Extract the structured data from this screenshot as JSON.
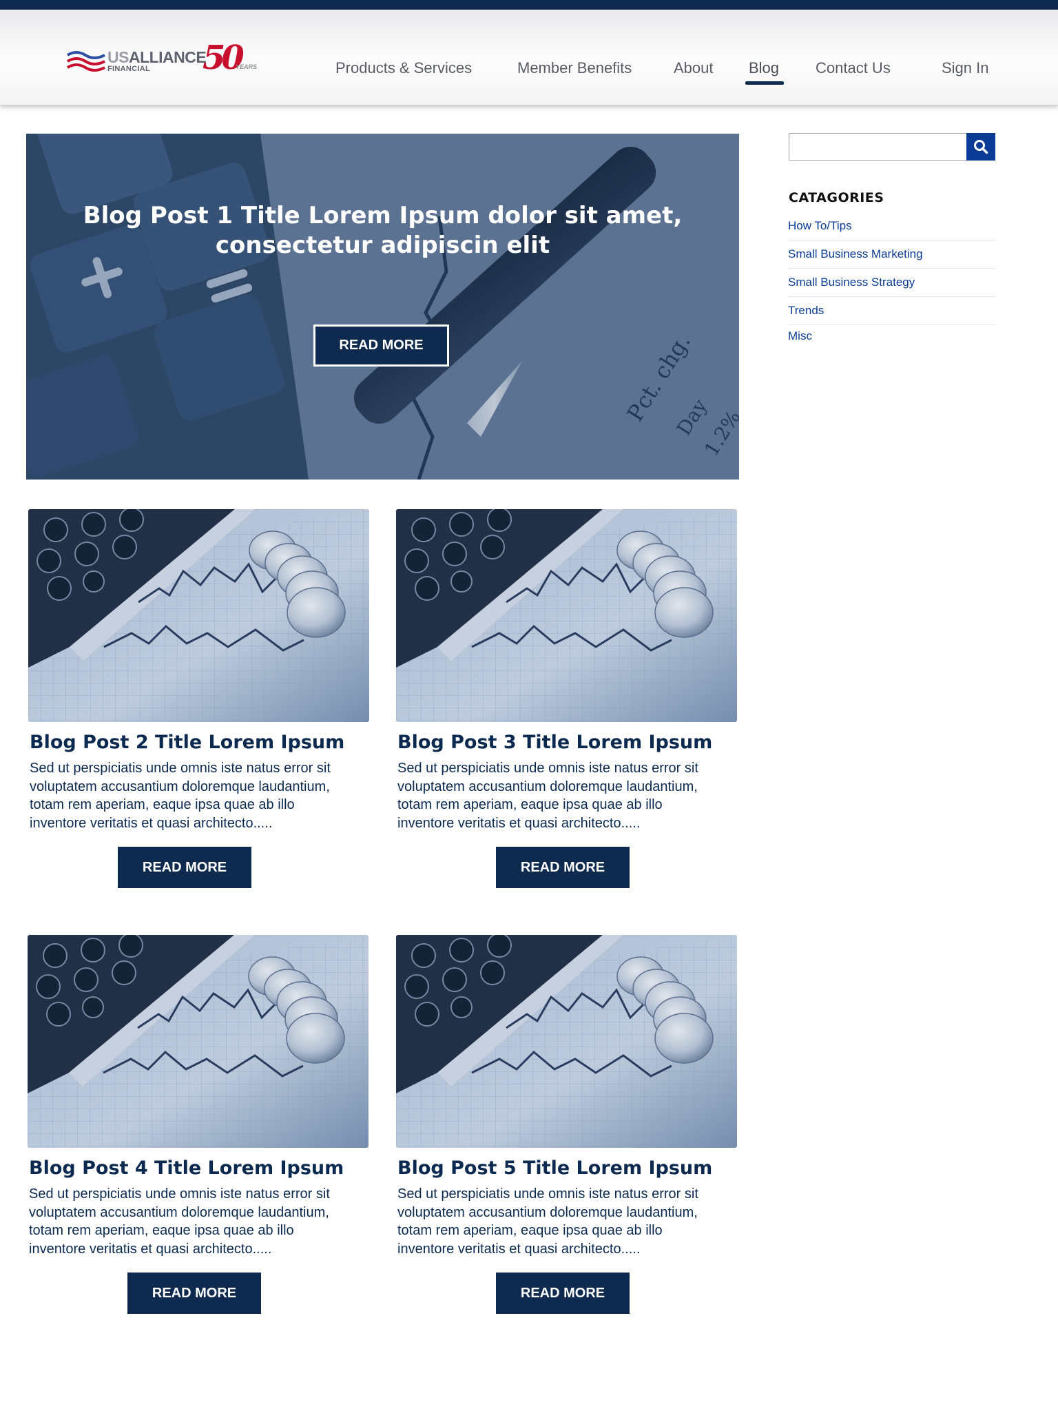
{
  "header": {
    "logo": {
      "us": "US",
      "alliance": "ALLIANCE",
      "financial": "FINANCIAL",
      "anniversary": "50",
      "years": "YEARS"
    },
    "nav": [
      "Products & Services",
      "Member Benefits",
      "About",
      "Blog",
      "Contact Us"
    ],
    "active_nav": "Blog",
    "sign_in": "Sign In"
  },
  "hero": {
    "title_line1": "Blog Post 1 Title Lorem Ipsum dolor sit amet,",
    "title_line2": "consectetur adipiscin elit",
    "button": "READ MORE"
  },
  "sidebar": {
    "search": {
      "value": "",
      "placeholder": ""
    },
    "categories_title": "CATAGORIES",
    "categories": [
      "How To/Tips",
      "Small Business Marketing",
      "Small Business Strategy",
      "Trends",
      "Misc"
    ]
  },
  "posts": [
    {
      "title": "Blog Post 2 Title Lorem Ipsum",
      "lines": [
        "Sed ut perspiciatis unde omnis iste natus error sit",
        "voluptatem accusantium doloremque laudantium,",
        "totam rem aperiam, eaque ipsa quae ab illo",
        "inventore veritatis et quasi architecto....."
      ],
      "button": "READ MORE"
    },
    {
      "title": "Blog Post 3 Title Lorem Ipsum",
      "lines": [
        "Sed ut perspiciatis unde omnis iste natus error sit",
        "voluptatem accusantium doloremque laudantium,",
        "totam rem aperiam, eaque ipsa quae ab illo",
        "inventore veritatis et quasi architecto....."
      ],
      "button": "READ MORE"
    },
    {
      "title": "Blog Post 4 Title Lorem Ipsum",
      "lines": [
        "Sed ut perspiciatis unde omnis iste natus error sit",
        "voluptatem accusantium doloremque laudantium,",
        "totam rem aperiam, eaque ipsa quae ab illo",
        "inventore veritatis et quasi architecto....."
      ],
      "button": "READ MORE"
    },
    {
      "title": "Blog Post 5 Title Lorem Ipsum",
      "lines": [
        "Sed ut perspiciatis unde omnis iste natus error sit",
        "voluptatem accusantium doloremque laudantium,",
        "totam rem aperiam, eaque ipsa quae ab illo",
        "inventore veritatis et quasi architecto....."
      ],
      "button": "READ MORE"
    }
  ],
  "colors": {
    "navy": "#0e2a4e",
    "link_blue": "#0b3c95",
    "brand_red": "#c8102e"
  },
  "icons": {
    "search": "search-icon",
    "logo_flag": "flag-stripes-icon"
  }
}
